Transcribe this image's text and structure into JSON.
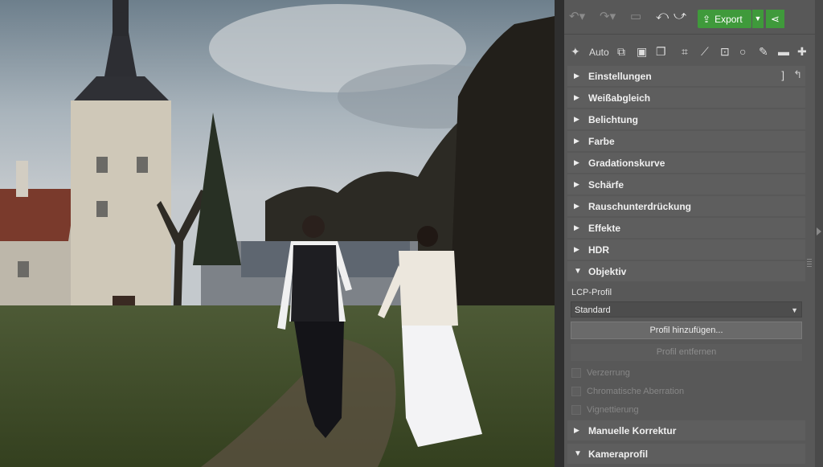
{
  "app": {
    "accent": "#3f9a3b"
  },
  "toolbar": {
    "undo_icon": "undo-icon",
    "redo_icon": "redo-icon",
    "image_icon": "image-icon",
    "rotate_left_icon": "rotate-left-icon",
    "rotate_right_icon": "rotate-right-icon",
    "export_label": "Export",
    "share_icon": "share-icon"
  },
  "tools": {
    "auto_label": "Auto",
    "icons": [
      "magic-wand-icon",
      "copy-settings-icon",
      "paste-settings-icon",
      "paste-all-icon",
      "crop-icon",
      "perspective-icon",
      "text-icon",
      "circle-icon",
      "brush-icon",
      "eraser-icon",
      "bandage-icon"
    ]
  },
  "sections": [
    {
      "label": "Einstellungen",
      "open": false
    },
    {
      "label": "Weißabgleich",
      "open": false
    },
    {
      "label": "Belichtung",
      "open": false
    },
    {
      "label": "Farbe",
      "open": false
    },
    {
      "label": "Gradationskurve",
      "open": false
    },
    {
      "label": "Schärfe",
      "open": false
    },
    {
      "label": "Rauschunterdrückung",
      "open": false
    },
    {
      "label": "Effekte",
      "open": false
    },
    {
      "label": "HDR",
      "open": false
    },
    {
      "label": "Objektiv",
      "open": true
    }
  ],
  "objektiv": {
    "lcp_label": "LCP-Profil",
    "profile_value": "Standard",
    "add_profile": "Profil hinzufügen...",
    "remove_profile": "Profil entfernen",
    "checks": [
      "Verzerrung",
      "Chromatische Aberration",
      "Vignettierung"
    ]
  },
  "sections_after": [
    {
      "label": "Manuelle Korrektur",
      "open": false
    },
    {
      "label": "Kameraprofil",
      "open": true
    }
  ],
  "photo": {
    "description_icon": "photo-canvas"
  }
}
